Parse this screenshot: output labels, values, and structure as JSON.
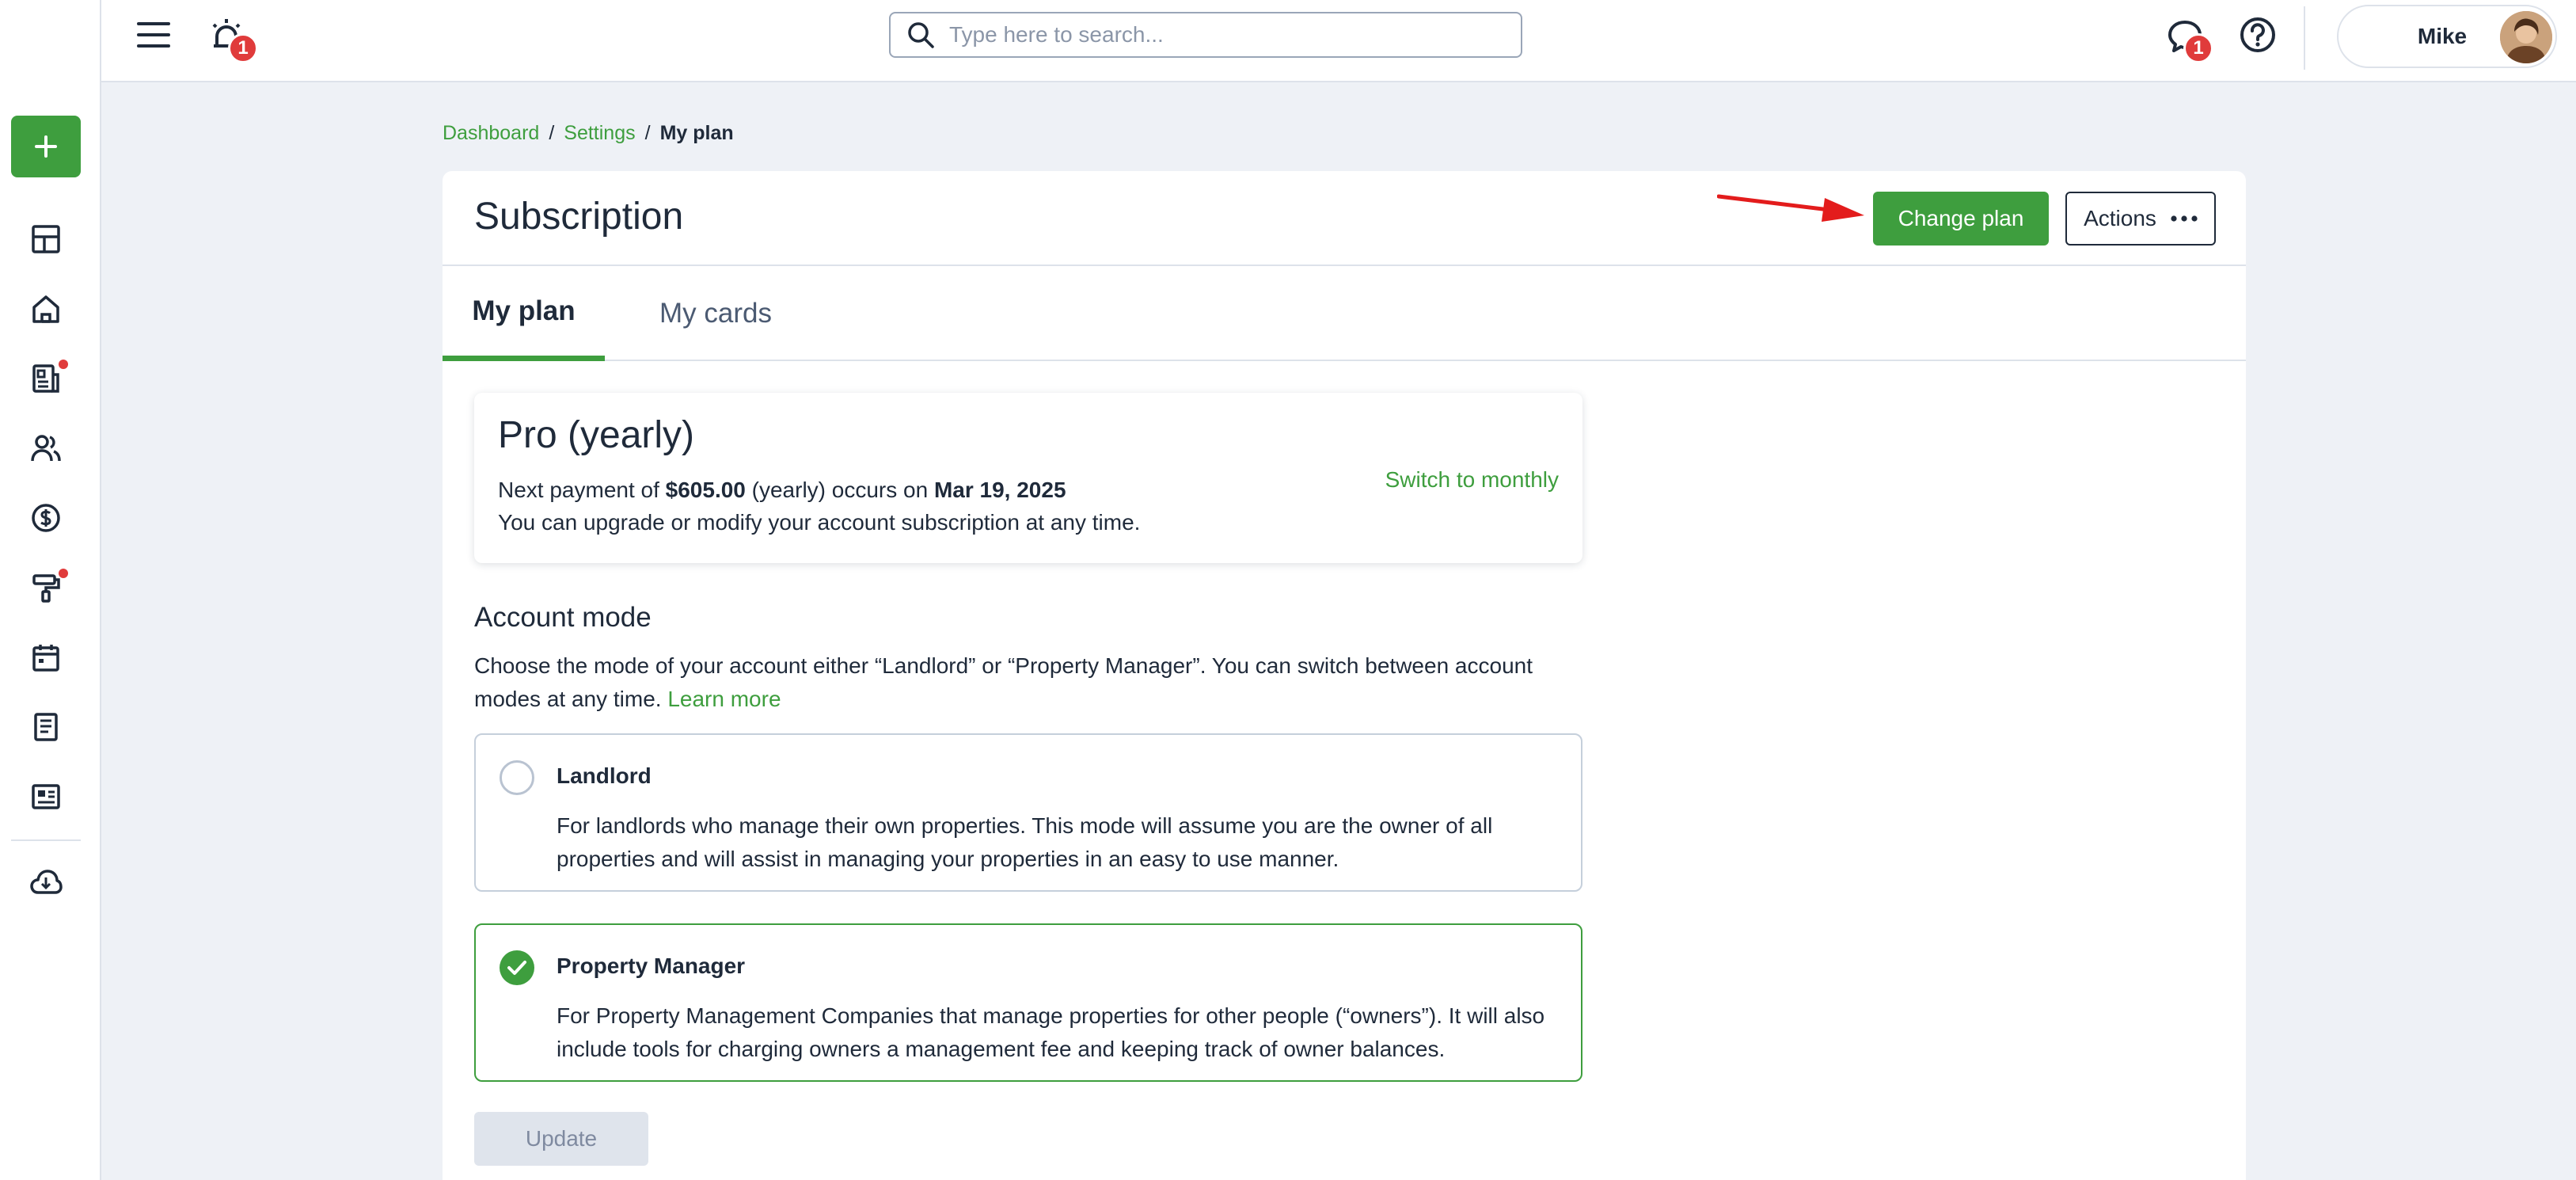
{
  "topbar": {
    "notifications_count": "1",
    "messages_count": "1",
    "search_placeholder": "Type here to search...",
    "user_name": "Mike"
  },
  "breadcrumb": {
    "items": [
      "Dashboard",
      "Settings",
      "My plan"
    ]
  },
  "page": {
    "title": "Subscription",
    "change_plan_label": "Change plan",
    "actions_label": "Actions"
  },
  "tabs": [
    "My plan",
    "My cards"
  ],
  "plan": {
    "name": "Pro (yearly)",
    "line1_prefix": "Next payment of ",
    "amount": "$605.00",
    "line1_mid": " (yearly) occurs on ",
    "date": "Mar 19, 2025",
    "line2": "You can upgrade or modify your account subscription at any time.",
    "switch_label": "Switch to monthly"
  },
  "account_mode": {
    "title": "Account mode",
    "description": "Choose the mode of your account either “Landlord” or “Property Manager”. You can switch between account modes at any time. ",
    "learn_more": "Learn more",
    "options": [
      {
        "title": "Landlord",
        "description": "For landlords who manage their own properties. This mode will assume you are the owner of all properties and will assist in managing your properties in an easy to use manner.",
        "selected": false
      },
      {
        "title": "Property Manager",
        "description": "For Property Management Companies that manage properties for other people (“owners”). It will also include tools for charging owners a management fee and keeping track of owner balances.",
        "selected": true
      }
    ],
    "update_label": "Update"
  },
  "colors": {
    "accent": "#3e9e3e",
    "badge": "#e03b3b",
    "text": "#1f2a3a",
    "background": "#eef1f6"
  }
}
